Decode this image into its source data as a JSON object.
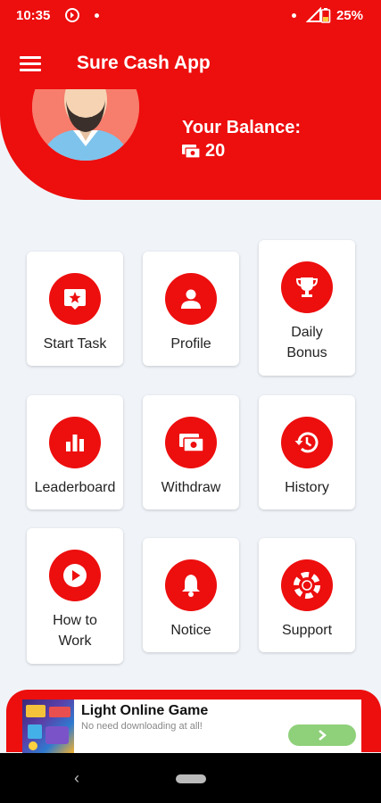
{
  "status_bar": {
    "time": "10:35",
    "battery": "25%"
  },
  "app_bar": {
    "title": "Sure Cash App"
  },
  "header": {
    "balance_label": "Your Balance:",
    "balance_value": "20"
  },
  "menu": [
    {
      "label": "Start Task",
      "icon": "task-star-icon"
    },
    {
      "label": "Profile",
      "icon": "person-icon"
    },
    {
      "label": "Daily\nBonus",
      "icon": "trophy-icon"
    },
    {
      "label": "Leaderboard",
      "icon": "bar-chart-icon"
    },
    {
      "label": "Withdraw",
      "icon": "cash-icon"
    },
    {
      "label": "History",
      "icon": "history-icon"
    },
    {
      "label": "How to\nWork",
      "icon": "play-icon"
    },
    {
      "label": "Notice",
      "icon": "bell-icon"
    },
    {
      "label": "Support",
      "icon": "lifebuoy-icon"
    }
  ],
  "ad": {
    "title": "Light Online Game",
    "subtitle": "No need downloading at all!"
  },
  "colors": {
    "brand_red": "#ed0e0e",
    "background": "#f0f4f9"
  }
}
